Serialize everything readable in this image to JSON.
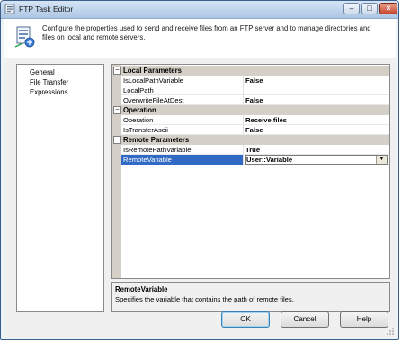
{
  "window": {
    "title": "FTP Task Editor",
    "controls": {
      "minimize": "–",
      "maximize": "□",
      "close": "×"
    }
  },
  "header": {
    "description": "Configure the properties used to send and receive files from an FTP server and to manage directories and files on local and remote servers.",
    "icon": "ftp-task-icon"
  },
  "nav": {
    "items": [
      {
        "label": "General"
      },
      {
        "label": "File Transfer"
      },
      {
        "label": "Expressions"
      }
    ],
    "selected": "File Transfer"
  },
  "grid": {
    "toggle_symbol": "–",
    "categories": [
      {
        "label": "Local Parameters",
        "properties": [
          {
            "name": "IsLocalPathVariable",
            "value": "False"
          },
          {
            "name": "LocalPath",
            "value": ""
          },
          {
            "name": "OverwriteFileAtDest",
            "value": "False"
          }
        ]
      },
      {
        "label": "Operation",
        "properties": [
          {
            "name": "Operation",
            "value": "Receive files"
          },
          {
            "name": "IsTransferAscii",
            "value": "False"
          }
        ]
      },
      {
        "label": "Remote Parameters",
        "properties": [
          {
            "name": "IsRemotePathVariable",
            "value": "True"
          },
          {
            "name": "RemoteVariable",
            "value": "User::Variable"
          }
        ]
      }
    ],
    "selected_property": "RemoteVariable",
    "dropdown_symbol": "▼"
  },
  "help": {
    "title": "RemoteVariable",
    "text": "Specifies the variable that contains the path of remote files."
  },
  "buttons": {
    "ok": "OK",
    "cancel": "Cancel",
    "help": "Help"
  },
  "colors": {
    "selection": "#316ac5",
    "category_band": "#d4d0c8",
    "title_bar": "#bfd4ec"
  }
}
